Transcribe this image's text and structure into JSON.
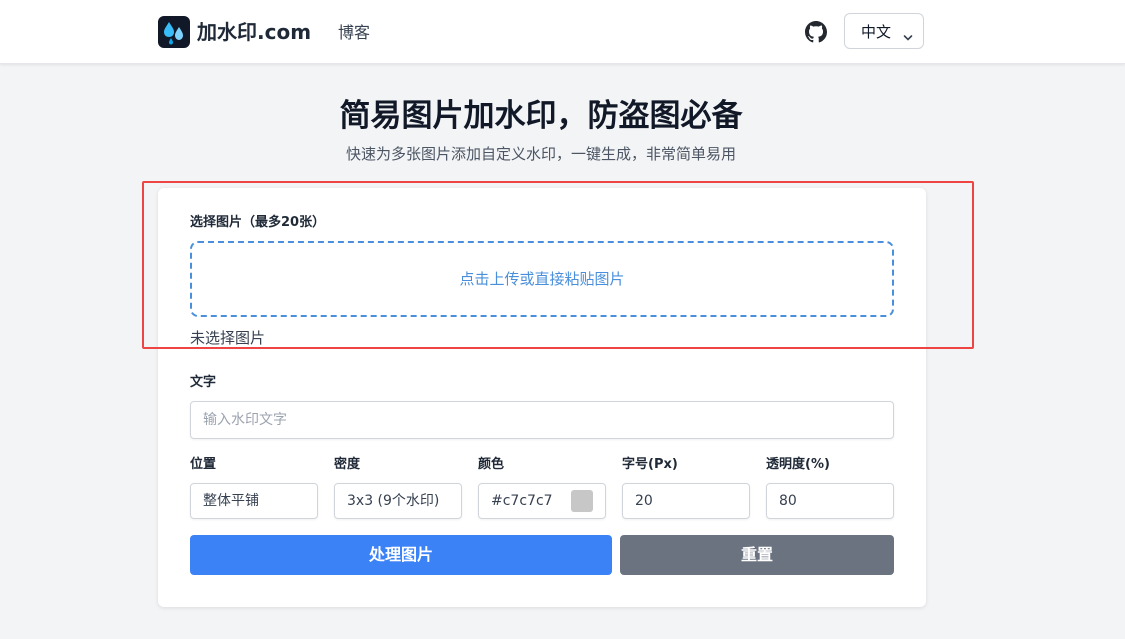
{
  "nav": {
    "brand": "加水印.com",
    "blog_label": "博客",
    "github_icon": "github-icon",
    "language_selected": "中文"
  },
  "hero": {
    "title": "简易图片加水印，防盗图必备",
    "subtitle": "快速为多张图片添加自定义水印，一键生成，非常简单易用"
  },
  "form": {
    "select_images_label": "选择图片（最多20张）",
    "dropzone_text": "点击上传或直接粘贴图片",
    "no_images_text": "未选择图片",
    "text_label": "文字",
    "text_placeholder": "输入水印文字",
    "position_label": "位置",
    "position_value": "整体平铺",
    "density_label": "密度",
    "density_value": "3x3 (9个水印)",
    "color_label": "颜色",
    "color_value": "#c7c7c7",
    "fontsize_label": "字号(Px)",
    "fontsize_value": "20",
    "opacity_label": "透明度(%)",
    "opacity_value": "80",
    "process_button": "处理图片",
    "reset_button": "重置"
  },
  "colors": {
    "primary": "#3b82f6",
    "secondary": "#6b7280",
    "dropzone": "#4a8fdb",
    "swatch": "#c7c7c7",
    "highlight": "#ef4444"
  }
}
